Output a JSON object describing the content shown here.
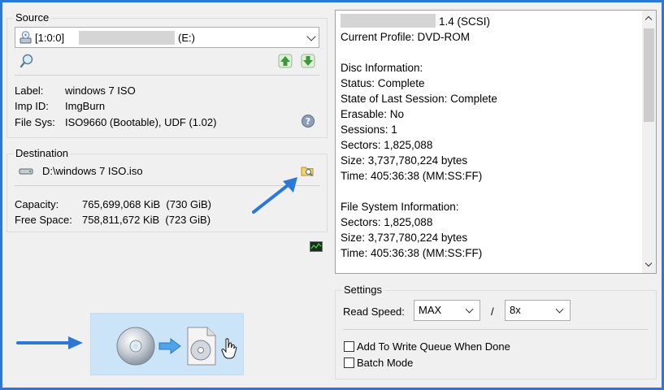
{
  "source": {
    "title": "Source",
    "drive_prefix": "[1:0:0]",
    "drive_suffix": "(E:)",
    "label_key": "Label:",
    "label_value": "windows 7 ISO",
    "imp_key": "Imp ID:",
    "imp_value": "ImgBurn",
    "fs_key": "File Sys:",
    "fs_value": "ISO9660 (Bootable), UDF (1.02)"
  },
  "destination": {
    "title": "Destination",
    "path": "D:\\windows 7 ISO.iso",
    "capacity_key": "Capacity:",
    "capacity_value": "765,699,068 KiB  (730 GiB)",
    "free_key": "Free Space:",
    "free_value": "758,811,672 KiB  (723 GiB)"
  },
  "info": {
    "lines": [
      "1.4 (SCSI)",
      "Current Profile: DVD-ROM",
      "",
      "Disc Information:",
      "Status: Complete",
      "State of Last Session: Complete",
      "Erasable: No",
      "Sessions: 1",
      "Sectors: 1,825,088",
      "Size: 3,737,780,224 bytes",
      "Time: 405:36:38 (MM:SS:FF)",
      "",
      "File System Information:",
      "Sectors: 1,825,088",
      "Size: 3,737,780,224 bytes",
      "Time: 405:36:38 (MM:SS:FF)"
    ]
  },
  "settings": {
    "title": "Settings",
    "read_speed_label": "Read Speed:",
    "read_speed_value": "MAX",
    "separator": "/",
    "verify_speed_value": "8x",
    "add_to_queue_label": "Add To Write Queue When Done",
    "add_to_queue_checked": false,
    "batch_mode_label": "Batch Mode",
    "batch_mode_checked": false
  },
  "colors": {
    "annotation_arrow": "#2b78d8",
    "frame": "#2b78d8"
  },
  "icons": [
    "drive-icon",
    "search-icon",
    "arrow-up-icon",
    "arrow-down-icon",
    "info-icon",
    "hdd-icon",
    "browse-folder-icon",
    "log-icon",
    "disc-icon",
    "arrow-right-icon",
    "image-file-icon",
    "hand-cursor-icon"
  ]
}
